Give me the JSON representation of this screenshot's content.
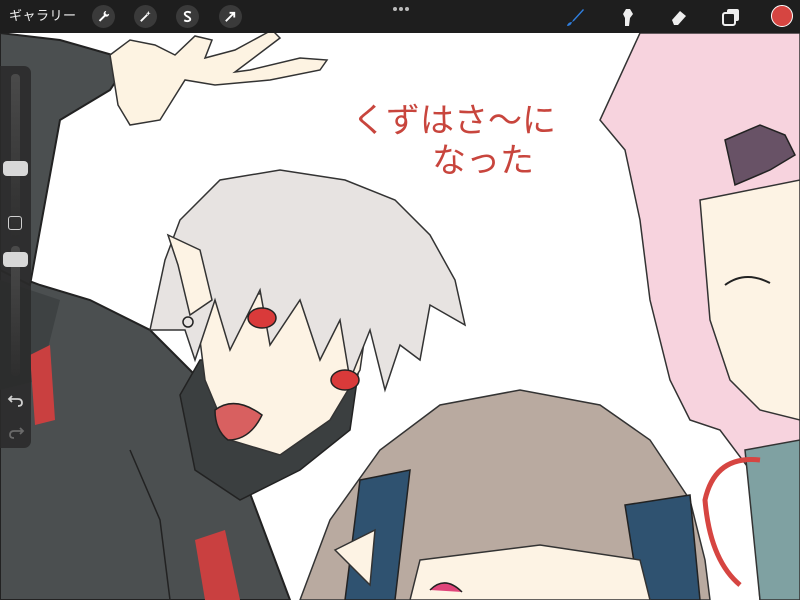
{
  "toolbar": {
    "gallery_label": "ギャラリー",
    "actions_icon": "wrench-icon",
    "adjustments_icon": "magic-wand-icon",
    "selection_icon": "selection-s-icon",
    "transform_icon": "arrow-cursor-icon",
    "brush_icon": "brush-icon",
    "smudge_icon": "smudge-icon",
    "eraser_icon": "eraser-icon",
    "layers_icon": "layers-icon",
    "menu_icon": "more-dots-icon",
    "current_color": "#d64541",
    "brush_active_color": "#2f7fe0"
  },
  "sidebar": {
    "brush_size_icon": "size-slider-icon",
    "modify_icon": "square-icon",
    "opacity_icon": "opacity-slider-icon",
    "undo_icon": "undo-icon",
    "redo_icon": "redo-icon"
  },
  "canvas": {
    "handwritten_line1": "くずはさ〜に",
    "handwritten_line2": "なった",
    "ink_color": "#c8453d"
  }
}
